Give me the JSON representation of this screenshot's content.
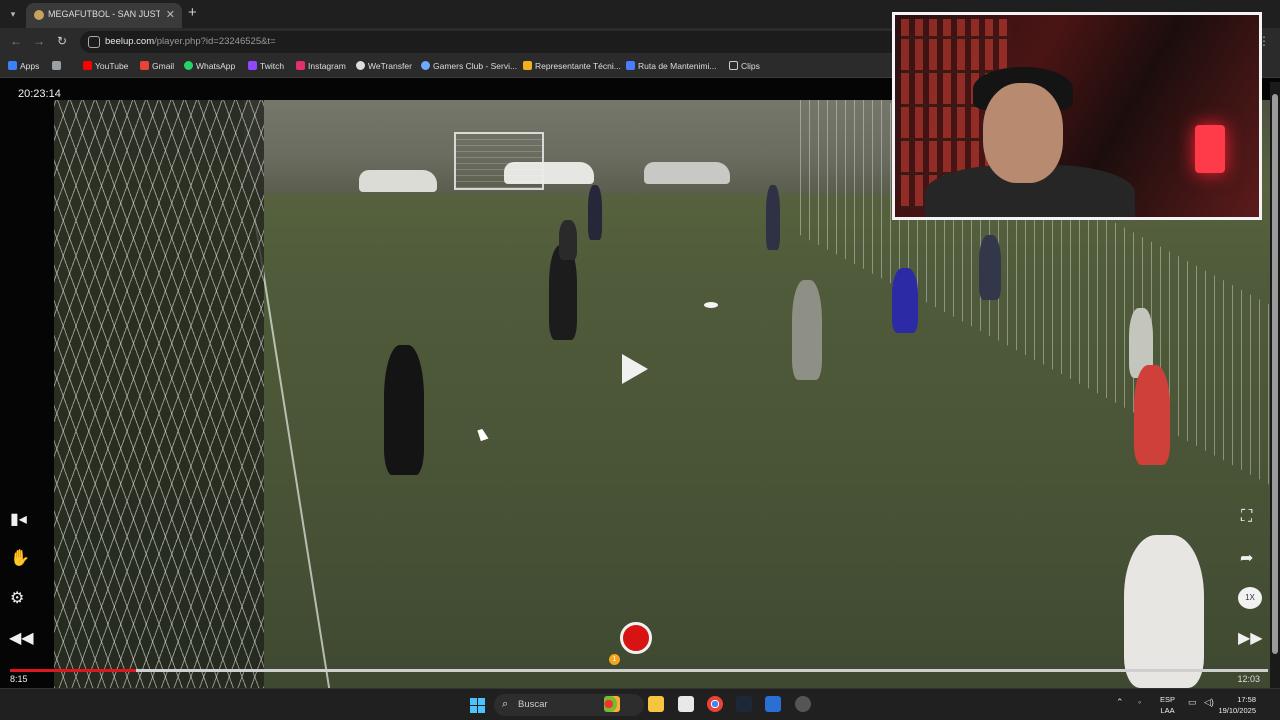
{
  "browser": {
    "tab_title": "MEGAFUTBOL - SAN JUSTO / F",
    "new_tab_glyph": "+",
    "close_glyph": "✕",
    "url_host": "beelup.com",
    "url_path": "/player.php?id=23246525&t=",
    "bookmarks": [
      {
        "label": "Apps",
        "color": "#3b82f6"
      },
      {
        "label": "",
        "color": "#9aa0a6"
      },
      {
        "label": "YouTube",
        "color": "#ff0000"
      },
      {
        "label": "Gmail",
        "color": "#ea4335"
      },
      {
        "label": "WhatsApp",
        "color": "#25d366"
      },
      {
        "label": "Twitch",
        "color": "#9146ff"
      },
      {
        "label": "Instagram",
        "color": "#e1306c"
      },
      {
        "label": "WeTransfer",
        "color": "#dddddd"
      },
      {
        "label": "Gamers Club - Servi...",
        "color": "#6ea8ff"
      },
      {
        "label": "Representante Técni...",
        "color": "#f2b01e"
      },
      {
        "label": "Ruta de Mantenimi...",
        "color": "#4a7cff"
      },
      {
        "label": "Clips",
        "color": "#cccccc"
      }
    ]
  },
  "player": {
    "clock_label": "20:23:14",
    "current_time": "8:15",
    "total_time": "12:03",
    "progress_fraction": 0.1,
    "marker_label": "1",
    "speed_label": "1X",
    "colors": {
      "record": "#d71313",
      "progress": "#e0151e",
      "marker": "#f3a61e"
    }
  },
  "taskbar": {
    "search_placeholder": "Buscar",
    "lang_line1": "ESP",
    "lang_line2": "LAA",
    "time": "17:58",
    "date": "19/10/2025"
  }
}
